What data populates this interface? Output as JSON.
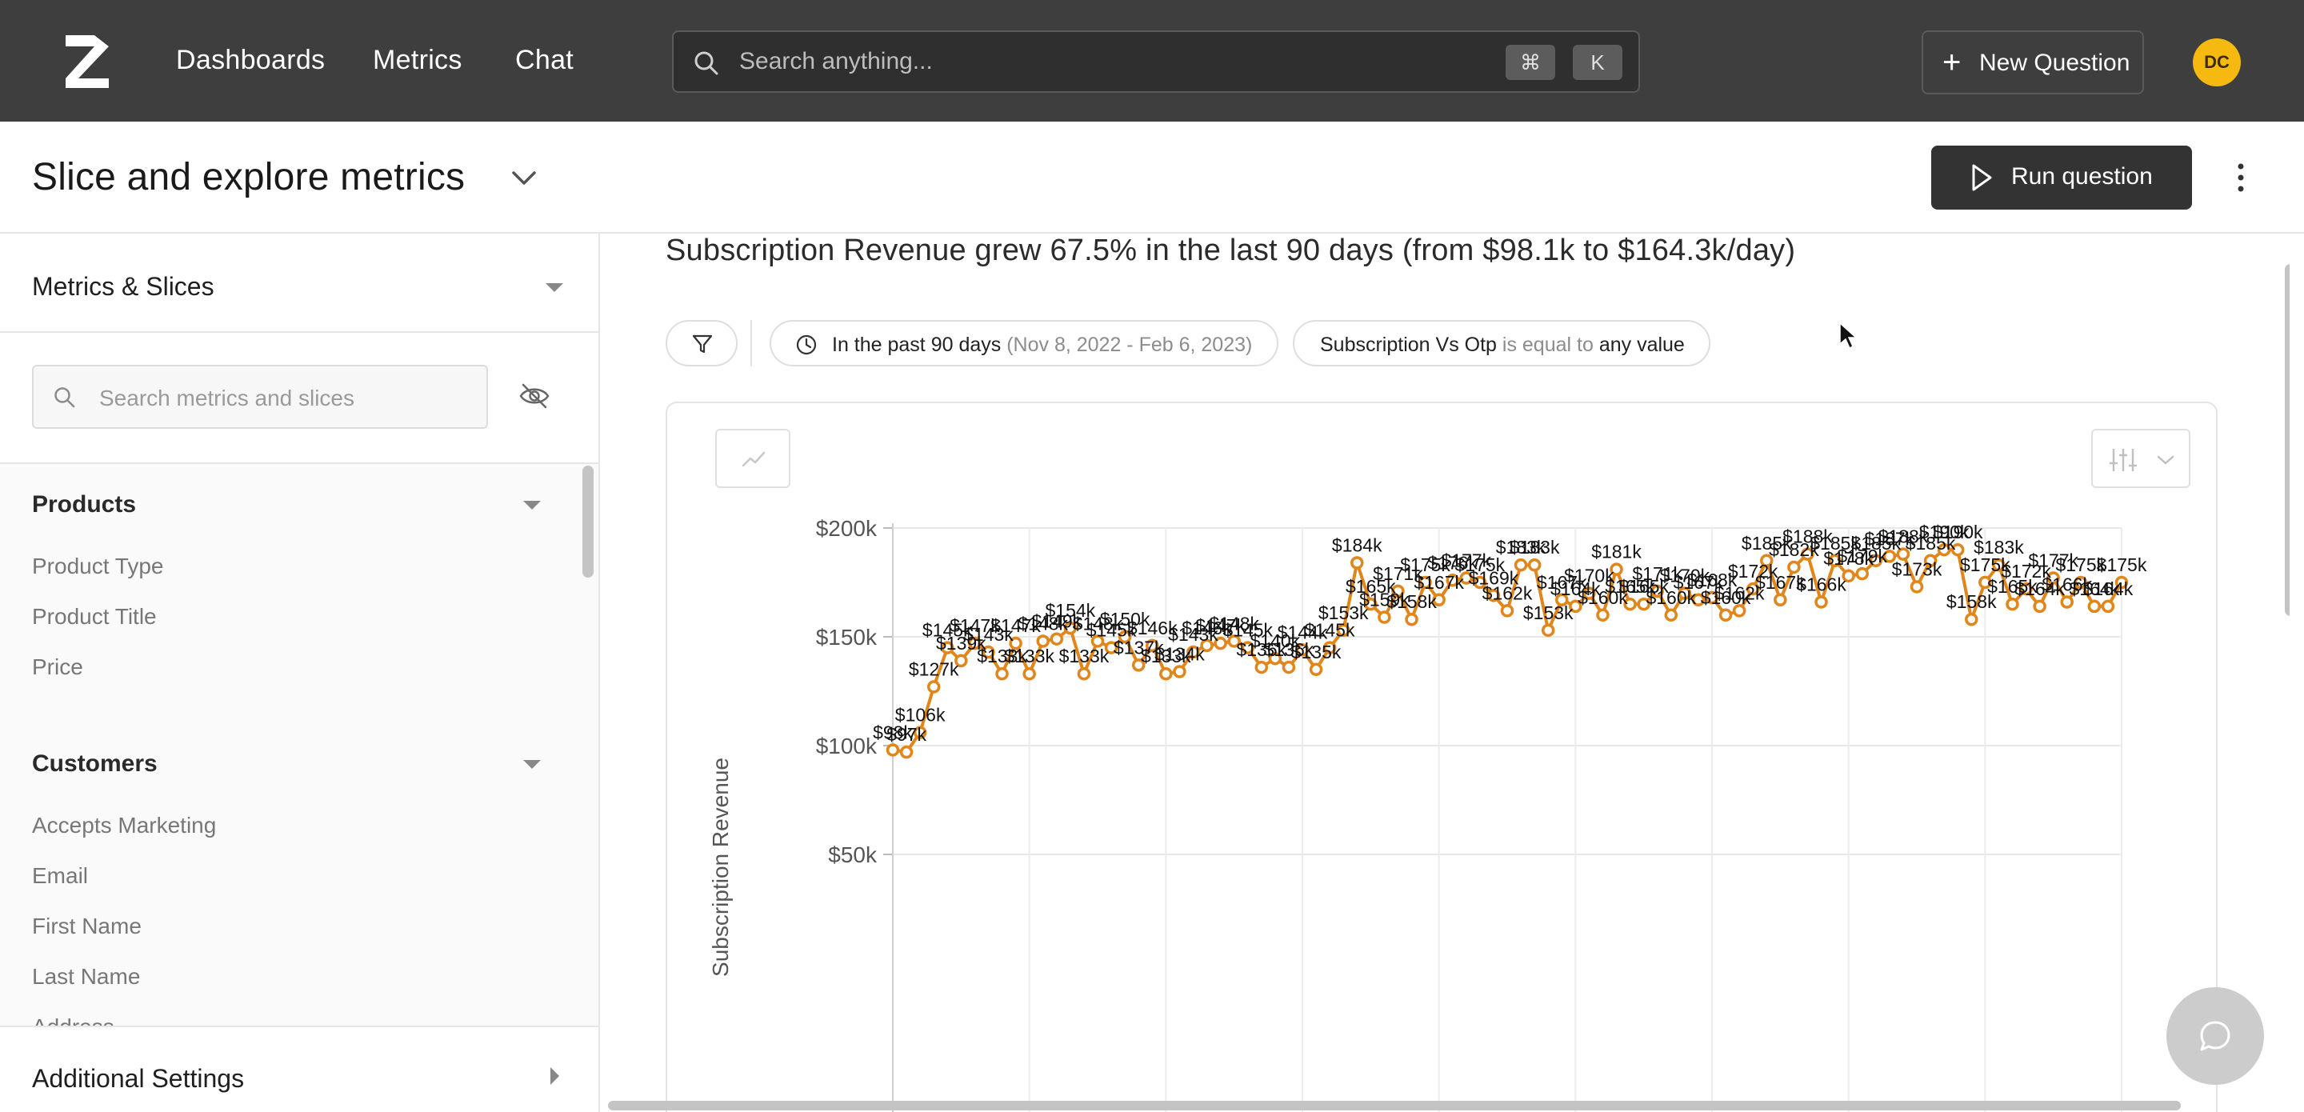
{
  "nav": {
    "links": [
      "Dashboards",
      "Metrics",
      "Chat"
    ],
    "search_placeholder": "Search anything...",
    "shortcut_keys": [
      "⌘",
      "K"
    ],
    "new_question_label": "New Question",
    "avatar_initials": "DC"
  },
  "header": {
    "title": "Slice and explore metrics",
    "run_label": "Run question"
  },
  "sidebar": {
    "metrics_title": "Metrics & Slices",
    "search_placeholder": "Search metrics and slices",
    "groups": [
      {
        "name": "Products",
        "items": [
          "Product Type",
          "Product Title",
          "Price"
        ]
      },
      {
        "name": "Customers",
        "items": [
          "Accepts Marketing",
          "Email",
          "First Name",
          "Last Name",
          "Address"
        ]
      }
    ],
    "additional_settings": "Additional Settings"
  },
  "main": {
    "headline": "Subscription Revenue grew 67.5% in the last 90 days (from $98.1k to $164.3k/day)",
    "date_filter": {
      "label": "In the past 90 days",
      "range": "(Nov 8, 2022 - Feb 6, 2023)"
    },
    "slice_filter": {
      "field": "Subscription Vs Otp",
      "op": "is equal to",
      "value": "any value"
    }
  },
  "colors": {
    "accent": "#e0861a",
    "nav_bg": "#3e3e3e",
    "avatar": "#f5b90f"
  },
  "chart_data": {
    "type": "line",
    "ylabel": "Subscription Revenue",
    "ytick_labels": [
      "$200k",
      "$150k",
      "$100k",
      "$50k"
    ],
    "yticks": [
      200,
      150,
      100,
      50
    ],
    "ylim": [
      30,
      200
    ],
    "x": [
      1,
      2,
      3,
      4,
      5,
      6,
      7,
      8,
      9,
      10,
      11,
      12,
      13,
      14,
      15,
      16,
      17,
      18,
      19,
      20,
      21,
      22,
      23,
      24,
      25,
      26,
      27,
      28,
      29,
      30,
      31,
      32,
      33,
      34,
      35,
      36,
      37,
      38,
      39,
      40,
      41,
      42,
      43,
      44,
      45,
      46,
      47,
      48,
      49,
      50,
      51,
      52,
      53,
      54,
      55,
      56,
      57,
      58,
      59,
      60,
      61,
      62,
      63,
      64,
      65,
      66,
      67,
      68,
      69,
      70,
      71,
      72,
      73,
      74,
      75,
      76,
      77,
      78,
      79,
      80,
      81,
      82,
      83,
      84,
      85,
      86,
      87,
      88,
      89,
      90,
      91
    ],
    "series": [
      {
        "values": [
          98,
          97,
          106,
          127,
          145,
          139,
          147,
          143,
          133,
          147,
          133,
          148,
          149,
          154,
          133,
          148,
          145,
          150,
          137,
          146,
          133,
          134,
          143,
          146,
          147,
          148,
          145,
          136,
          140,
          136,
          144,
          135,
          145,
          153,
          184,
          165,
          159,
          171,
          158,
          175,
          167,
          176,
          177,
          175,
          169,
          162,
          183,
          183,
          153,
          167,
          164,
          170,
          160,
          181,
          165,
          165,
          171,
          160,
          170,
          167,
          168,
          160,
          162,
          172,
          185,
          167,
          182,
          188,
          166,
          185,
          178,
          179,
          185,
          187,
          188,
          173,
          185,
          190,
          190,
          158,
          175,
          183,
          165,
          172,
          164,
          177,
          166,
          175,
          164,
          164,
          175
        ],
        "labels": [
          "$98k",
          "$97k",
          "$106k",
          "$127k",
          "$145k",
          "$139k",
          "$147k",
          "$143k",
          "$133k",
          "$147k",
          "$133k",
          "$148k",
          "$149k",
          "$154k",
          "$133k",
          "$148k",
          "$145k",
          "$150k",
          "$137k",
          "$146k",
          "$133k",
          "$134k",
          "$143k",
          "$146k",
          "$147k",
          "$148k",
          "$145k",
          "$136k",
          "$140k",
          "$136k",
          "$144k",
          "$135k",
          "$145k",
          "$153k",
          "$184k",
          "$165k",
          "$159k",
          "$171k",
          "$158k",
          "$175k",
          "$167k",
          "$176k",
          "$177k",
          "$175k",
          "$169k",
          "$162k",
          "$183k",
          "$183k",
          "$153k",
          "$167k",
          "$164k",
          "$170k",
          "$160k",
          "$181k",
          "$165k",
          "$165k",
          "$171k",
          "$160k",
          "$170k",
          "$167k",
          "$168k",
          "$160k",
          "$162k",
          "$172k",
          "$185k",
          "$167k",
          "$182k",
          "$188k",
          "$166k",
          "$185k",
          "$178k",
          "$179k",
          "$185k",
          "$187k",
          "$188k",
          "$173k",
          "$185k",
          "$190k",
          "$190k",
          "$158k",
          "$175k",
          "$183k",
          "$165k",
          "$172k",
          "$164k",
          "$177k",
          "$166k",
          "$175k",
          "$164k",
          "$164k",
          "$175k"
        ]
      }
    ]
  }
}
